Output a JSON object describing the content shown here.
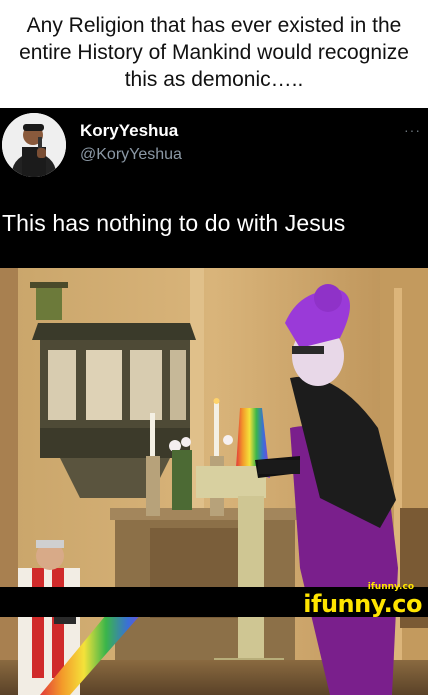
{
  "meme": {
    "caption": "Any Religion that has ever existed in the entire History of Mankind would recognize this as demonic….."
  },
  "tweet": {
    "author_name": "KoryYeshua",
    "author_handle": "@KoryYeshua",
    "more_icon": "ellipsis-icon",
    "text": "This has nothing to do with Jesus"
  },
  "watermark": {
    "small": "ifunny.co",
    "big": "ifunny.co"
  },
  "colors": {
    "tweet_background": "#000000",
    "handle_gray": "#8b98a5",
    "watermark_yellow": "#ffe500"
  }
}
